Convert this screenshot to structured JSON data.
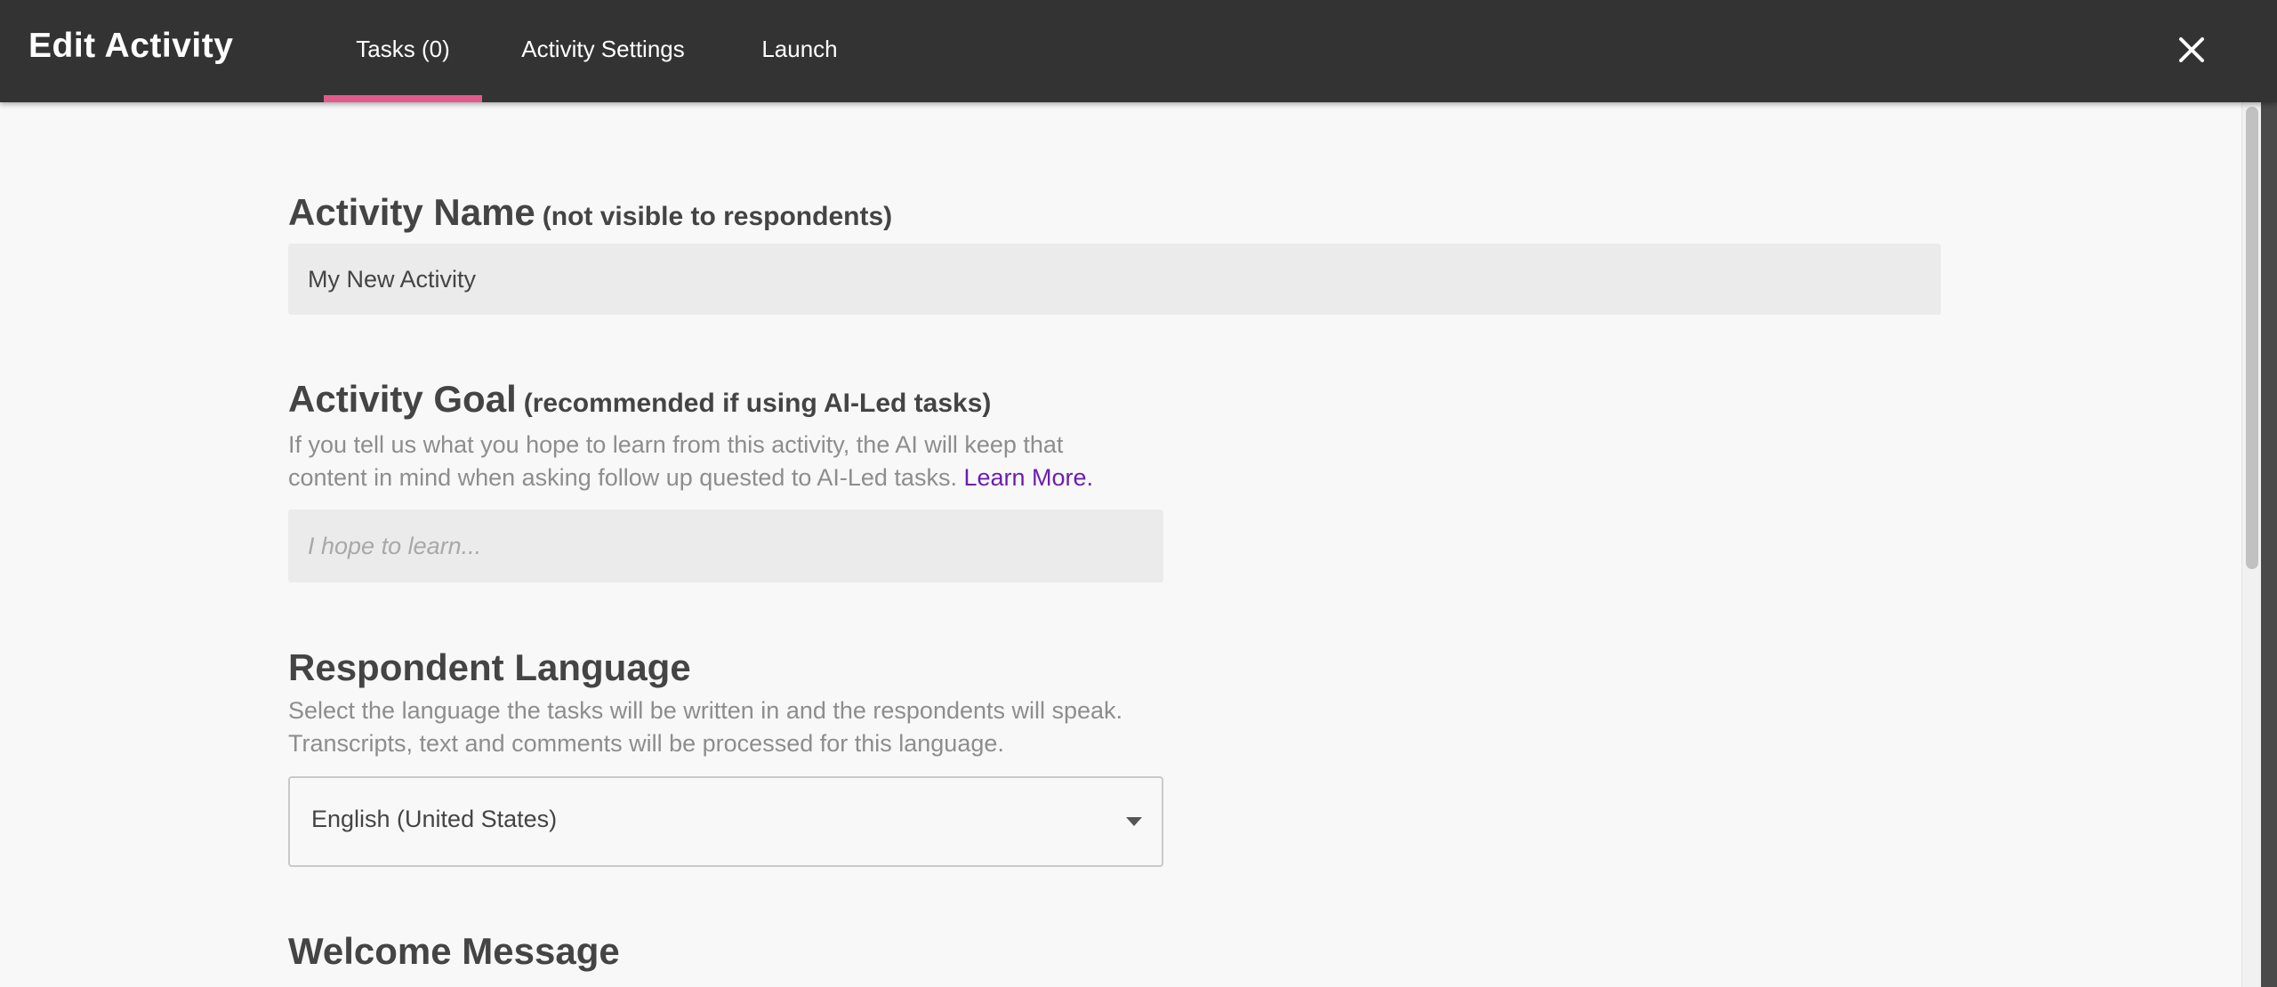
{
  "header": {
    "title": "Edit Activity",
    "tabs": [
      {
        "label": "Tasks (0)",
        "active": true
      },
      {
        "label": "Activity Settings",
        "active": false
      },
      {
        "label": "Launch",
        "active": false
      }
    ],
    "close_icon": "close-icon"
  },
  "form": {
    "activity_name": {
      "title": "Activity Name",
      "note": "(not visible to respondents)",
      "value": "My New Activity"
    },
    "activity_goal": {
      "title": "Activity Goal",
      "note": "(recommended if using AI-Led tasks)",
      "help_line1": "If you tell us what you hope to learn from this activity, the AI will keep that",
      "help_line2": "content in mind when asking follow up quested to AI-Led tasks.",
      "learn_more": "Learn More.",
      "placeholder": "I hope to learn..."
    },
    "respondent_language": {
      "title": "Respondent Language",
      "help_line1": "Select the language the tasks will be written in and the respondents will speak.",
      "help_line2": "Transcripts, text and comments will be processed for this language.",
      "selected": "English (United States)"
    },
    "welcome_message": {
      "title": "Welcome Message"
    }
  },
  "colors": {
    "header_bg": "#333333",
    "tab_indicator": "#e05a8a",
    "link": "#6a1fb0",
    "page_bg": "#f8f8f8"
  }
}
